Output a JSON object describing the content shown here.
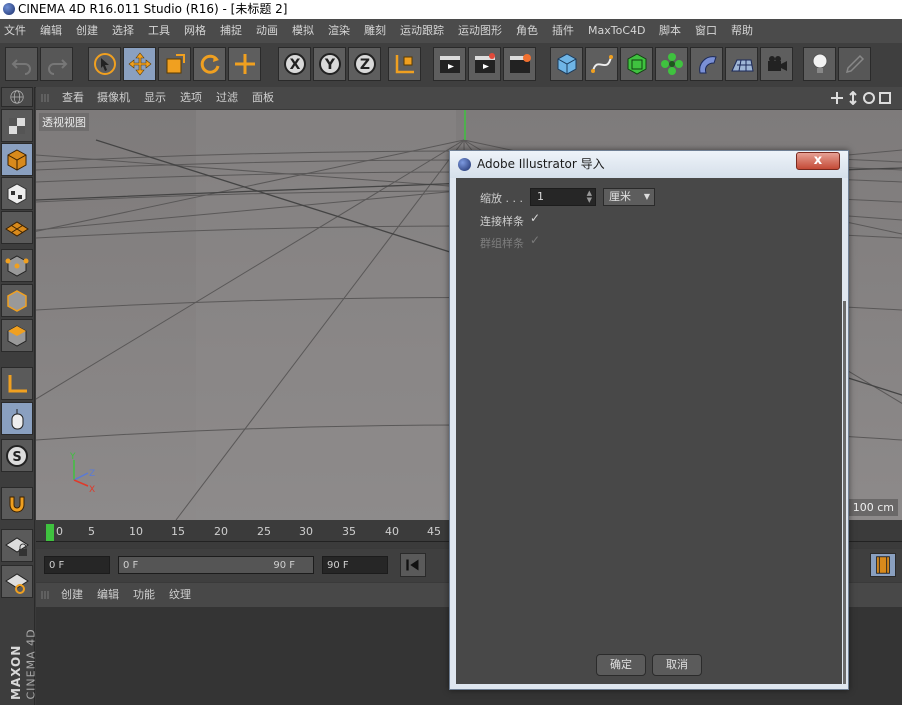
{
  "window": {
    "title": "CINEMA 4D R16.011 Studio (R16) - [未标题 2]"
  },
  "menubar": [
    "文件",
    "编辑",
    "创建",
    "选择",
    "工具",
    "网格",
    "捕捉",
    "动画",
    "模拟",
    "渲染",
    "雕刻",
    "运动跟踪",
    "运动图形",
    "角色",
    "插件",
    "MaxToC4D",
    "脚本",
    "窗口",
    "帮助"
  ],
  "viewport_menu": [
    "查看",
    "摄像机",
    "显示",
    "选项",
    "过滤",
    "面板"
  ],
  "viewport": {
    "label": "透视视图",
    "scale": "100 cm"
  },
  "timeline": {
    "ticks": [
      "0",
      "5",
      "10",
      "15",
      "20",
      "25",
      "30",
      "35",
      "40",
      "45"
    ]
  },
  "controls": {
    "start_frame": "0 F",
    "current_frame": "0 F",
    "range_end": "90 F",
    "end_frame": "90 F"
  },
  "bottom_menu": [
    "创建",
    "编辑",
    "功能",
    "纹理"
  ],
  "logo": {
    "line1": "MAXON",
    "line2": "CINEMA 4D"
  },
  "dialog": {
    "title": "Adobe Illustrator 导入",
    "close": "x",
    "scale_label": "缩放 . . .",
    "scale_value": "1",
    "unit": "厘米",
    "connect_splines": "连接样条",
    "group_splines": "群组样条",
    "ok": "确定",
    "cancel": "取消"
  },
  "colors": {
    "accent_orange": "#f0a020",
    "dialog_close": "#c44a36",
    "viewport_bg": "#8a8787"
  }
}
